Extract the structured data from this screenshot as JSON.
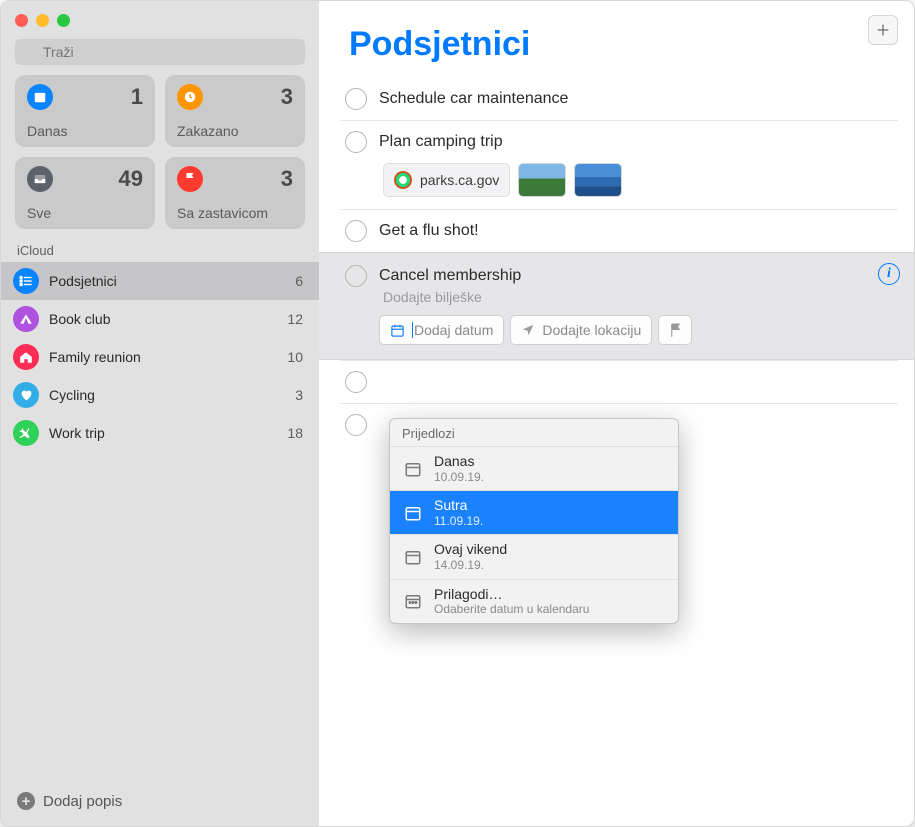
{
  "colors": {
    "accent": "#007aff"
  },
  "search": {
    "placeholder": "Traži"
  },
  "smart": [
    {
      "label": "Danas",
      "count": "1",
      "color": "#0a84ff",
      "icon": "calendar"
    },
    {
      "label": "Zakazano",
      "count": "3",
      "color": "#ff9500",
      "icon": "clock"
    },
    {
      "label": "Sve",
      "count": "49",
      "color": "#5b626a",
      "icon": "tray"
    },
    {
      "label": "Sa zastavicom",
      "count": "3",
      "color": "#ff3b30",
      "icon": "flag"
    }
  ],
  "sidebar": {
    "section": "iCloud",
    "lists": [
      {
        "name": "Podsjetnici",
        "count": "6",
        "color": "#0a84ff",
        "icon": "list",
        "selected": true
      },
      {
        "name": "Book club",
        "count": "12",
        "color": "#af52de",
        "icon": "tent",
        "selected": false
      },
      {
        "name": "Family reunion",
        "count": "10",
        "color": "#ff2d55",
        "icon": "house",
        "selected": false
      },
      {
        "name": "Cycling",
        "count": "3",
        "color": "#32ade6",
        "icon": "heart",
        "selected": false
      },
      {
        "name": "Work trip",
        "count": "18",
        "color": "#30d158",
        "icon": "plane",
        "selected": false
      }
    ],
    "add_list": "Dodaj popis"
  },
  "main": {
    "title": "Podsjetnici",
    "reminders": [
      {
        "title": "Schedule car maintenance"
      },
      {
        "title": "Plan camping trip",
        "attachments": {
          "link": "parks.ca.gov",
          "thumbs": 2
        }
      },
      {
        "title": "Get a flu shot!"
      }
    ],
    "editing": {
      "title": "Cancel membership",
      "notes_placeholder": "Dodajte bilješke",
      "add_date": "Dodaj datum",
      "add_location": "Dodajte lokaciju"
    },
    "after": [
      {
        "title": ""
      },
      {
        "title": ""
      }
    ]
  },
  "popup": {
    "header": "Prijedlozi",
    "items": [
      {
        "label": "Danas",
        "sub": "10.09.19.",
        "selected": false
      },
      {
        "label": "Sutra",
        "sub": "11.09.19.",
        "selected": true
      },
      {
        "label": "Ovaj vikend",
        "sub": "14.09.19.",
        "selected": false
      },
      {
        "label": "Prilagodi…",
        "sub": "Odaberite datum u kalendaru",
        "selected": false
      }
    ]
  }
}
